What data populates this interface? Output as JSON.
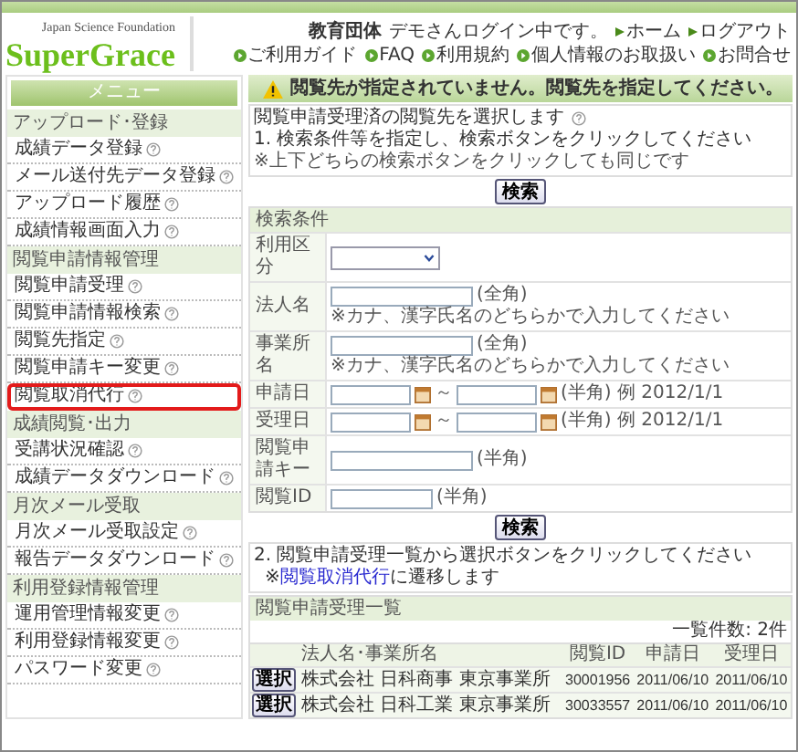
{
  "header": {
    "org": "Japan Science Foundation",
    "logo": "SuperGrace",
    "user_type": "教育団体",
    "login_message": "デモさんログイン中です。",
    "top_links": [
      "ホーム",
      "ログアウト"
    ],
    "nav_links": [
      "ご利用ガイド",
      "FAQ",
      "利用規約",
      "個人情報のお取扱い",
      "お問合せ"
    ]
  },
  "sidebar": {
    "title": "メニュー",
    "sections": [
      {
        "label": "アップロード･登録",
        "items": [
          {
            "label": "成績データ登録",
            "selected": false
          },
          {
            "label": "メール送付先データ登録",
            "selected": false
          },
          {
            "label": "アップロード履歴",
            "selected": false
          },
          {
            "label": "成績情報画面入力",
            "selected": false
          }
        ]
      },
      {
        "label": "閲覧申請情報管理",
        "items": [
          {
            "label": "閲覧申請受理",
            "selected": false
          },
          {
            "label": "閲覧申請情報検索",
            "selected": false
          },
          {
            "label": "閲覧先指定",
            "selected": false
          },
          {
            "label": "閲覧申請キー変更",
            "selected": false
          },
          {
            "label": "閲覧取消代行",
            "selected": true
          }
        ]
      },
      {
        "label": "成績閲覧･出力",
        "items": [
          {
            "label": "受講状況確認",
            "selected": false
          },
          {
            "label": "成績データダウンロード",
            "selected": false
          }
        ]
      },
      {
        "label": "月次メール受取",
        "items": [
          {
            "label": "月次メール受取設定",
            "selected": false
          },
          {
            "label": "報告データダウンロード",
            "selected": false
          }
        ]
      },
      {
        "label": "利用登録情報管理",
        "items": [
          {
            "label": "運用管理情報変更",
            "selected": false
          },
          {
            "label": "利用登録情報変更",
            "selected": false
          },
          {
            "label": "パスワード変更",
            "selected": false
          }
        ]
      }
    ]
  },
  "alert": "閲覧先が指定されていません。閲覧先を指定してください。",
  "intro": {
    "line": "閲覧申請受理済の閲覧先を選択します",
    "step": "1. 検索条件等を指定し、検索ボタンをクリックしてください",
    "note": "※上下どちらの検索ボタンをクリックしても同じです"
  },
  "search_button_top": "検索",
  "form": {
    "title": "検索条件",
    "rows": [
      {
        "kind": "select",
        "label": "利用区分"
      },
      {
        "kind": "text",
        "label": "法人名",
        "note": "(全角)",
        "hint": "※カナ、漢字氏名のどちらかで入力してください"
      },
      {
        "kind": "text",
        "label": "事業所名",
        "note": "(全角)",
        "hint": "※カナ、漢字氏名のどちらかで入力してください"
      },
      {
        "kind": "date_range",
        "label": "申請日",
        "separator": "～",
        "note": "(半角) 例 2012/1/1"
      },
      {
        "kind": "date_range",
        "label": "受理日",
        "separator": "～",
        "note": "(半角) 例 2012/1/1"
      },
      {
        "kind": "text",
        "label": "閲覧申請キー",
        "note": "(半角)"
      },
      {
        "kind": "short",
        "label": "閲覧ID",
        "note": "(半角)"
      }
    ]
  },
  "search_button_bottom": "検索",
  "step2": {
    "text": "2. 閲覧申請受理一覧から選択ボタンをクリックしてください",
    "prefix": "※",
    "link": "閲覧取消代行",
    "suffix": "に遷移します"
  },
  "list": {
    "title": "閲覧申請受理一覧",
    "count": "一覧件数: 2件",
    "columns": [
      "法人名･事業所名",
      "閲覧ID",
      "申請日",
      "受理日"
    ],
    "rows": [
      {
        "button": "選択",
        "name": "株式会社 日科商事 東京事業所",
        "id": "30001956",
        "applied": "2011/06/10",
        "accepted": "2011/06/10"
      },
      {
        "button": "選択",
        "name": "株式会社 日科工業 東京事業所",
        "id": "30033557",
        "applied": "2011/06/10",
        "accepted": "2011/06/10"
      }
    ]
  }
}
